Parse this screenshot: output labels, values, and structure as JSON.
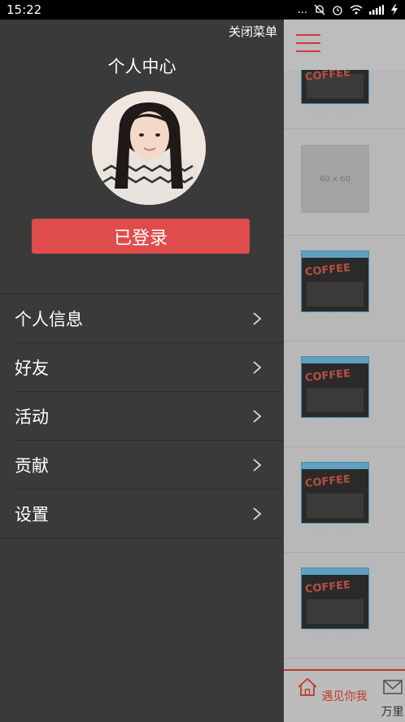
{
  "status_bar": {
    "time": "15:22",
    "dots": "...",
    "battery_icon": "charging-battery-icon"
  },
  "drawer": {
    "close_label": "关闭菜单",
    "title": "个人中心",
    "login_label": "已登录",
    "menu": [
      {
        "label": "个人信息"
      },
      {
        "label": "好友"
      },
      {
        "label": "活动"
      },
      {
        "label": "贡献"
      },
      {
        "label": "设置"
      }
    ]
  },
  "content": {
    "placeholder_text": "60 x 60",
    "tabs": [
      {
        "label": "遇见你我",
        "icon": "home-icon",
        "active": true
      },
      {
        "label": "万里",
        "icon": "envelope-icon",
        "active": false
      }
    ]
  },
  "colors": {
    "accent": "#de4d4b",
    "drawer_bg": "#3a3a3a",
    "content_bg": "#b8b8b8",
    "tab_active": "#c0392b"
  }
}
